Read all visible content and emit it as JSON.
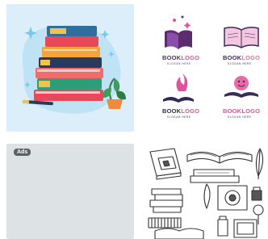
{
  "gallery": {
    "tiles": [
      {
        "name": "book-stack-illustration"
      },
      {
        "name": "book-logo-set",
        "logos": [
          {
            "word1": "BOOK",
            "word2": "LOGO",
            "slogan": "SLOGAN HERE",
            "color1": "#5a2d6e",
            "color2": "#e0529c"
          },
          {
            "word1": "BOOK",
            "word2": "LOGO",
            "slogan": "SLOGAN HERE",
            "color1": "#3a2b5e",
            "color2": "#e96aa6"
          },
          {
            "word1": "BOOK",
            "word2": "LOGO",
            "slogan": "SLOGAN HERE",
            "color1": "#2f2a55",
            "color2": "#e0529c"
          },
          {
            "word1": "BOOK",
            "word2": "LOGO",
            "slogan": "SLOGAN HERE",
            "color1": "#e0529c",
            "color2": "#e0529c"
          }
        ]
      },
      {
        "name": "advertisement",
        "badge": "Ads"
      },
      {
        "name": "book-sketch-illustration"
      }
    ]
  }
}
